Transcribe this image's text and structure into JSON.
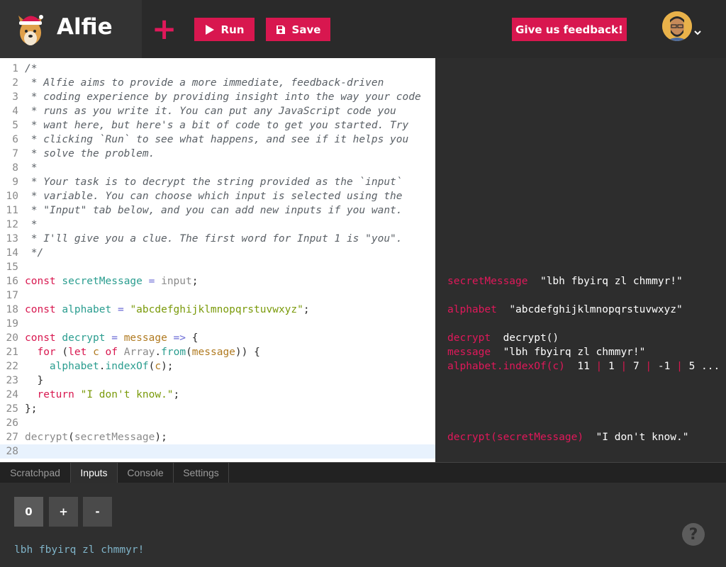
{
  "app": {
    "name": "Alfie"
  },
  "toolbar": {
    "run_label": "Run",
    "save_label": "Save",
    "feedback_label": "Give us feedback!",
    "new_icon": "plus-icon"
  },
  "editor": {
    "lines": [
      {
        "n": "1",
        "code": "/*"
      },
      {
        "n": "2",
        "code": " * Alfie aims to provide a more immediate, feedback-driven"
      },
      {
        "n": "3",
        "code": " * coding experience by providing insight into the way your code"
      },
      {
        "n": "4",
        "code": " * runs as you write it. You can put any JavaScript code you"
      },
      {
        "n": "5",
        "code": " * want here, but here's a bit of code to get you started. Try"
      },
      {
        "n": "6",
        "code": " * clicking `Run` to see what happens, and see if it helps you"
      },
      {
        "n": "7",
        "code": " * solve the problem."
      },
      {
        "n": "8",
        "code": " *"
      },
      {
        "n": "9",
        "code": " * Your task is to decrypt the string provided as the `input`"
      },
      {
        "n": "10",
        "code": " * variable. You can choose which input is selected using the"
      },
      {
        "n": "11",
        "code": " * \"Input\" tab below, and you can add new inputs if you want."
      },
      {
        "n": "12",
        "code": " *"
      },
      {
        "n": "13",
        "code": " * I'll give you a clue. The first word for Input 1 is \"you\"."
      },
      {
        "n": "14",
        "code": " */"
      },
      {
        "n": "15",
        "code": ""
      },
      {
        "n": "16",
        "code": "const secretMessage = input;"
      },
      {
        "n": "17",
        "code": ""
      },
      {
        "n": "18",
        "code": "const alphabet = \"abcdefghijklmnopqrstuvwxyz\";"
      },
      {
        "n": "19",
        "code": ""
      },
      {
        "n": "20",
        "code": "const decrypt = message => {"
      },
      {
        "n": "21",
        "code": "  for (let c of Array.from(message)) {"
      },
      {
        "n": "22",
        "code": "    alphabet.indexOf(c);"
      },
      {
        "n": "23",
        "code": "  }"
      },
      {
        "n": "24",
        "code": "  return \"I don't know.\";"
      },
      {
        "n": "25",
        "code": "};"
      },
      {
        "n": "26",
        "code": ""
      },
      {
        "n": "27",
        "code": "decrypt(secretMessage);"
      },
      {
        "n": "28",
        "code": ""
      }
    ]
  },
  "insight": {
    "rows": [
      {
        "line": 16,
        "key": "secretMessage",
        "value": "\"lbh fbyirq zl chmmyr!\""
      },
      {
        "line": 18,
        "key": "alphabet",
        "value": "\"abcdefghijklmnopqrstuvwxyz\""
      },
      {
        "line": 20,
        "key": "decrypt",
        "value": "decrypt()"
      },
      {
        "line": 21,
        "key": "message",
        "value": "\"lbh fbyirq zl chmmyr!\""
      },
      {
        "line": 22,
        "key": "alphabet.indexOf(c)",
        "values": [
          "11",
          "1",
          "7",
          "-1",
          "5"
        ],
        "more": "..."
      },
      {
        "line": 27,
        "key": "decrypt(secretMessage)",
        "value": "\"I don't know.\""
      }
    ]
  },
  "tabs": [
    {
      "label": "Scratchpad",
      "active": false
    },
    {
      "label": "Inputs",
      "active": true
    },
    {
      "label": "Console",
      "active": false
    },
    {
      "label": "Settings",
      "active": false
    }
  ],
  "inputs": {
    "selected": "0",
    "add_label": "+",
    "remove_label": "-",
    "value": "lbh fbyirq zl chmmyr!"
  },
  "help": {
    "label": "?"
  },
  "colors": {
    "accent": "#d8174f",
    "editor_bg": "#ffffff",
    "panel_bg": "#2d2d2d"
  }
}
